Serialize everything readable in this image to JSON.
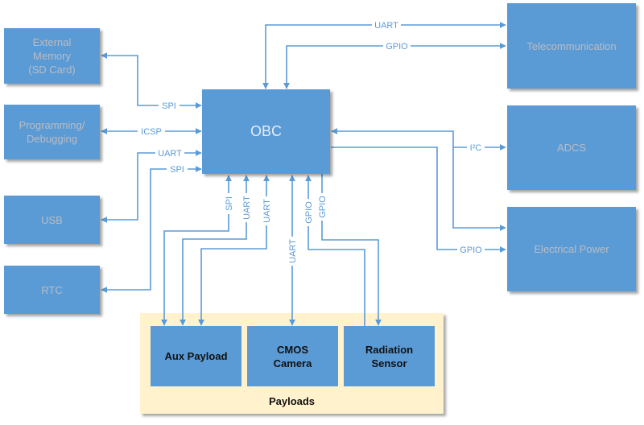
{
  "diagram": {
    "colors": {
      "box": "#5b9bd5",
      "line": "#5b9bd5",
      "payload_bg": "#fff2cc"
    },
    "center": {
      "label": "OBC"
    },
    "left_blocks": [
      {
        "id": "ext-mem",
        "label": "External\nMemory\n(SD Card)"
      },
      {
        "id": "prog",
        "label": "Programming/\nDebugging"
      },
      {
        "id": "usb",
        "label": "USB"
      },
      {
        "id": "rtc",
        "label": "RTC"
      }
    ],
    "right_blocks": [
      {
        "id": "telecom",
        "label": "Telecommunication"
      },
      {
        "id": "adcs",
        "label": "ADCS"
      },
      {
        "id": "eps",
        "label": "Electrical Power"
      }
    ],
    "payloads": {
      "title": "Payloads",
      "items": [
        {
          "id": "aux",
          "label": "Aux Payload"
        },
        {
          "id": "cmos",
          "label": "CMOS\nCamera"
        },
        {
          "id": "rad",
          "label": "Radiation\nSensor"
        }
      ]
    },
    "connections": [
      {
        "id": "obc-extmem",
        "label": "SPI",
        "from": "OBC",
        "to": "External Memory (SD Card)",
        "bidirectional": true
      },
      {
        "id": "obc-prog",
        "label": "ICSP",
        "from": "OBC",
        "to": "Programming/Debugging",
        "bidirectional": true
      },
      {
        "id": "obc-usb",
        "label": "UART",
        "from": "OBC",
        "to": "USB",
        "bidirectional": true
      },
      {
        "id": "obc-rtc",
        "label": "SPI",
        "from": "OBC",
        "to": "RTC",
        "bidirectional": true
      },
      {
        "id": "obc-telecom-uart",
        "label": "UART",
        "from": "OBC",
        "to": "Telecommunication",
        "bidirectional": true
      },
      {
        "id": "obc-telecom-gpio",
        "label": "GPIO",
        "from": "OBC",
        "to": "Telecommunication",
        "bidirectional": true
      },
      {
        "id": "obc-adcs",
        "label": "I²C",
        "from": "OBC",
        "to": "ADCS / Electrical Power",
        "bidirectional": true
      },
      {
        "id": "obc-eps-gpio",
        "label": "GPIO",
        "from": "OBC",
        "to": "Electrical Power",
        "bidirectional": false
      },
      {
        "id": "obc-aux-spi",
        "label": "SPI",
        "from": "OBC",
        "to": "Aux Payload",
        "bidirectional": true
      },
      {
        "id": "obc-aux-uart1",
        "label": "UART",
        "from": "OBC",
        "to": "Aux Payload",
        "bidirectional": true
      },
      {
        "id": "obc-aux-uart2",
        "label": "UART",
        "from": "OBC",
        "to": "Aux Payload",
        "bidirectional": true
      },
      {
        "id": "obc-cmos",
        "label": "UART",
        "from": "OBC",
        "to": "CMOS Camera",
        "bidirectional": true
      },
      {
        "id": "rad-obc-gpio",
        "label": "GPIO",
        "from": "Radiation Sensor",
        "to": "OBC",
        "bidirectional": false
      },
      {
        "id": "obc-rad-gpio",
        "label": "GPIO",
        "from": "OBC",
        "to": "Radiation Sensor",
        "bidirectional": false
      }
    ]
  }
}
